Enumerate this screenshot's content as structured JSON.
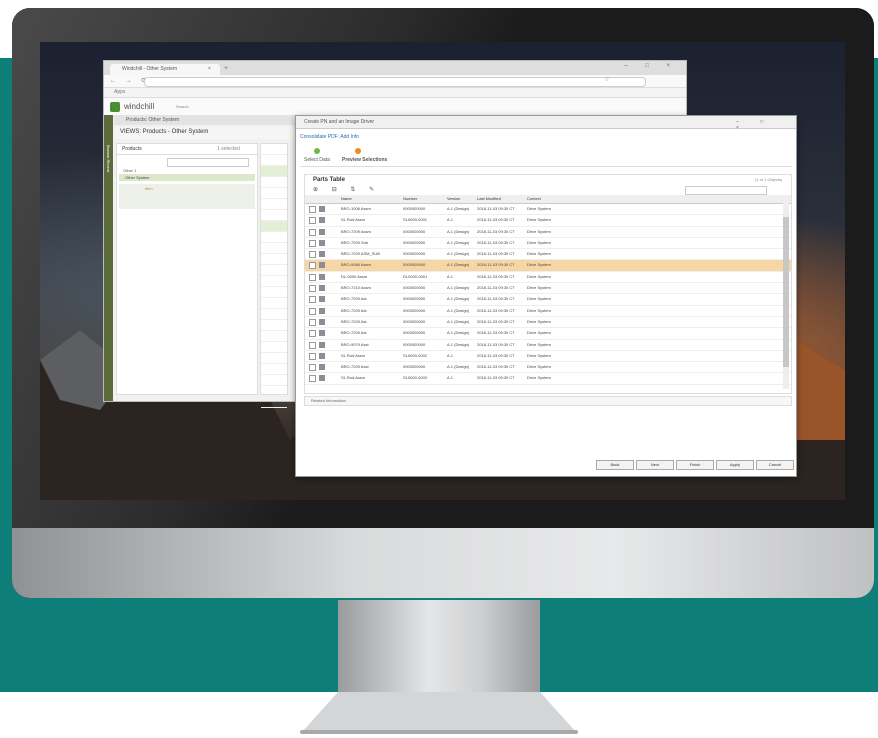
{
  "browser": {
    "tab_title": "Windchill - Other System",
    "tab_close": "×",
    "new_tab": "+",
    "window_controls": "– □ ×",
    "nav_icons": "← → ⟳",
    "bookmarks_label": "Apps"
  },
  "windchill": {
    "app_name": "windchill",
    "search_hint": "Search",
    "left_rail_label": "Browse Recent",
    "breadcrumb_bar": "Products: Other System",
    "context_title": "VIEWS: Products - Other System",
    "tree_header": "Products",
    "tree_header_right": "1 selected",
    "tree_root": "Other 1",
    "tree_selected": "Other System",
    "tree_child": "item"
  },
  "dialog": {
    "title": "Create PN and an Image Driver",
    "breadcrumb": "Consolidate PDF: Add Info",
    "steps": [
      "Select Data",
      "Preview Selections"
    ],
    "panel_title": "Parts Table",
    "panel_link": "(1 of 1 Objects)",
    "tool_icons": "⊕ ⊟ ⇅ ✎",
    "columns": [
      "Name",
      "Number",
      "Version",
      "Last Modified",
      "Context"
    ],
    "rows": [
      {
        "name": "BRO-1008 Assm",
        "number": "0000000000",
        "version": "A.1 (Design)",
        "modified": "2018-11-03 09:30 CT",
        "context": "Drive System"
      },
      {
        "name": "SL Rod Assm",
        "number": "SL0000-0001",
        "version": "A.1",
        "modified": "2018-11-03 09:30 CT",
        "context": "Drive System"
      },
      {
        "name": "BRO-7209 Assm",
        "number": "0000000000",
        "version": "A.1 (Design)",
        "modified": "2018-11-03 09:30 CT",
        "context": "Drive System"
      },
      {
        "name": "BRO-7209 Sub",
        "number": "0000000000",
        "version": "A.1 (Design)",
        "modified": "2018-11-03 09:30 CT",
        "context": "Drive System"
      },
      {
        "name": "BRO-7209 ASM_SUB",
        "number": "0000000000",
        "version": "A.1 (Design)",
        "modified": "2018-11-03 09:30 CT",
        "context": "Drive System"
      },
      {
        "name": "BRO-9066 Assm",
        "number": "0000000000",
        "version": "A.1 (Design)",
        "modified": "2018-11-03 09:30 CT",
        "context": "Drive System"
      },
      {
        "name": "DL-0090 Assm",
        "number": "DL0000-0001",
        "version": "A.1",
        "modified": "2018-11-03 09:30 CT",
        "context": "Drive System"
      },
      {
        "name": "BRO-7210 Assm",
        "number": "0000000000",
        "version": "A.1 (Design)",
        "modified": "2018-11-03 09:30 CT",
        "context": "Drive System"
      },
      {
        "name": "BRO-7209 Ast",
        "number": "0000000000",
        "version": "A.1 (Design)",
        "modified": "2018-11-03 09:30 CT",
        "context": "Drive System"
      },
      {
        "name": "BRO-7209 Ast",
        "number": "0000000000",
        "version": "A.1 (Design)",
        "modified": "2018-11-03 09:30 CT",
        "context": "Drive System"
      },
      {
        "name": "BRO-7209 Ast",
        "number": "0000000000",
        "version": "A.1 (Design)",
        "modified": "2018-11-03 09:30 CT",
        "context": "Drive System"
      },
      {
        "name": "BRO-7209 Ast",
        "number": "0000000000",
        "version": "A.1 (Design)",
        "modified": "2018-11-03 09:30 CT",
        "context": "Drive System"
      },
      {
        "name": "BRO-9079 Asst",
        "number": "0000000000",
        "version": "A.1 (Design)",
        "modified": "2018-11-03 09:30 CT",
        "context": "Drive System"
      },
      {
        "name": "SL Rod Assm",
        "number": "SL0000-0002",
        "version": "A.1",
        "modified": "2018-11-03 09:30 CT",
        "context": "Drive System"
      },
      {
        "name": "BRO-7209 Asst",
        "number": "0000000000",
        "version": "A.1 (Design)",
        "modified": "2018-11-03 09:30 CT",
        "context": "Drive System"
      },
      {
        "name": "SL Rod Assm",
        "number": "SL0000-0003",
        "version": "A.1",
        "modified": "2018-11-03 09:30 CT",
        "context": "Drive System"
      }
    ],
    "selected_row_index": 5,
    "secondary_panel": "Related Information",
    "buttons": [
      "Back",
      "Next",
      "Finish",
      "Apply",
      "Cancel"
    ]
  },
  "colors": {
    "teal": "#0e7f78",
    "row_highlight": "#f7d6a5",
    "step_done": "#6fba45",
    "step_current": "#f08a1c"
  }
}
